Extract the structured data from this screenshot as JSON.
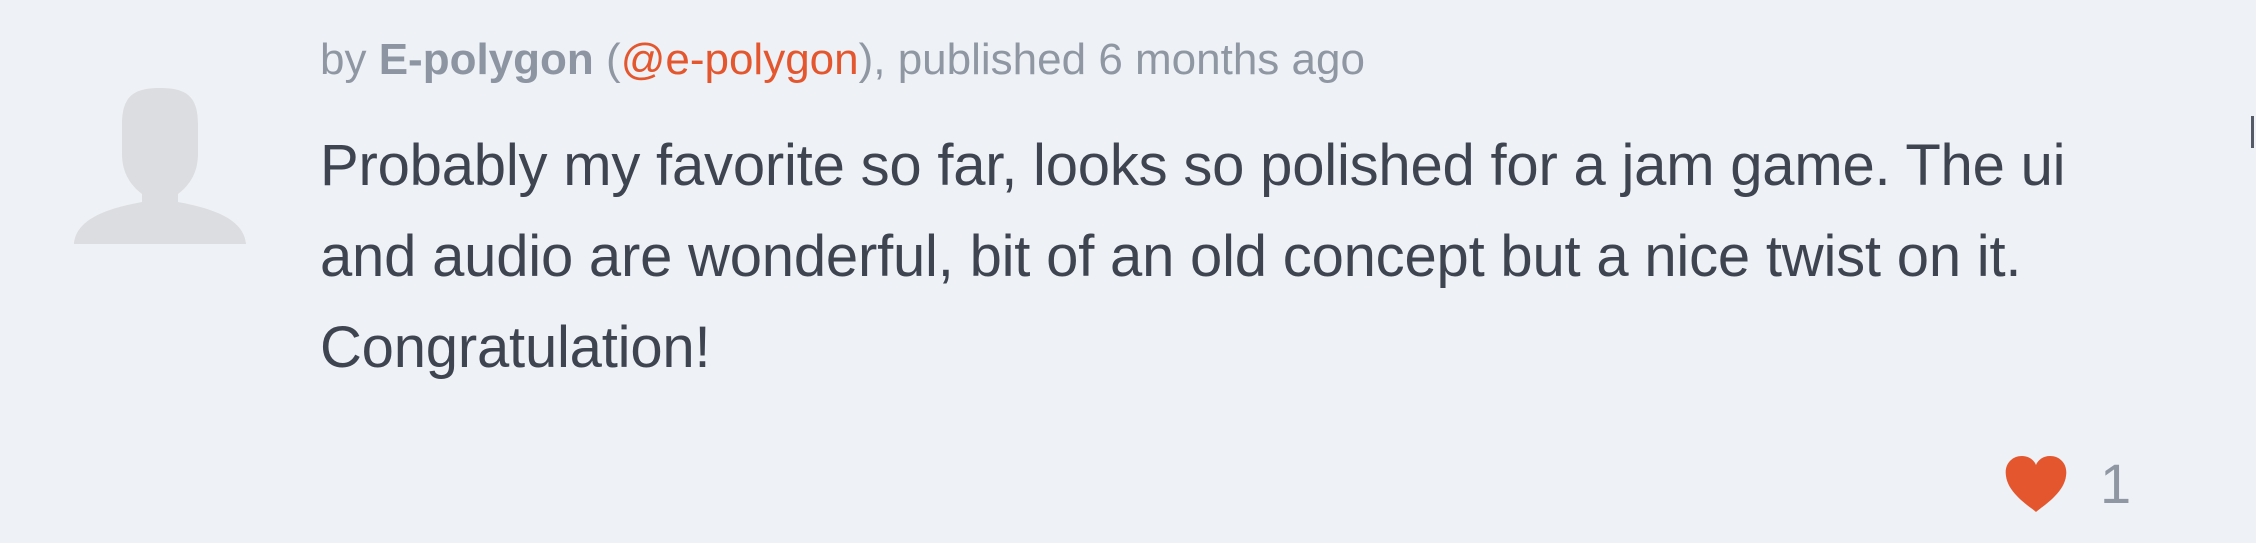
{
  "comment": {
    "by_prefix": "by ",
    "author_name": "E-polygon",
    "open_paren": " (",
    "author_handle": "@e-polygon",
    "close_paren": ")",
    "published_text": ", published 6 months ago",
    "body_lines": [
      "Probably my favorite so far, looks so polished for a jam game. The ui",
      "and audio are wonderful, bit of an old concept but a nice twist on it.",
      "Congratulation!"
    ],
    "like_count": "1"
  },
  "icons": {
    "avatar": "default-user-silhouette-icon",
    "like": "heart-icon"
  },
  "colors": {
    "background": "#eef1f6",
    "accent": "#e4572e",
    "meta_text": "#8f97a3",
    "body_text": "#3e4450",
    "avatar": "#dcdde0"
  }
}
